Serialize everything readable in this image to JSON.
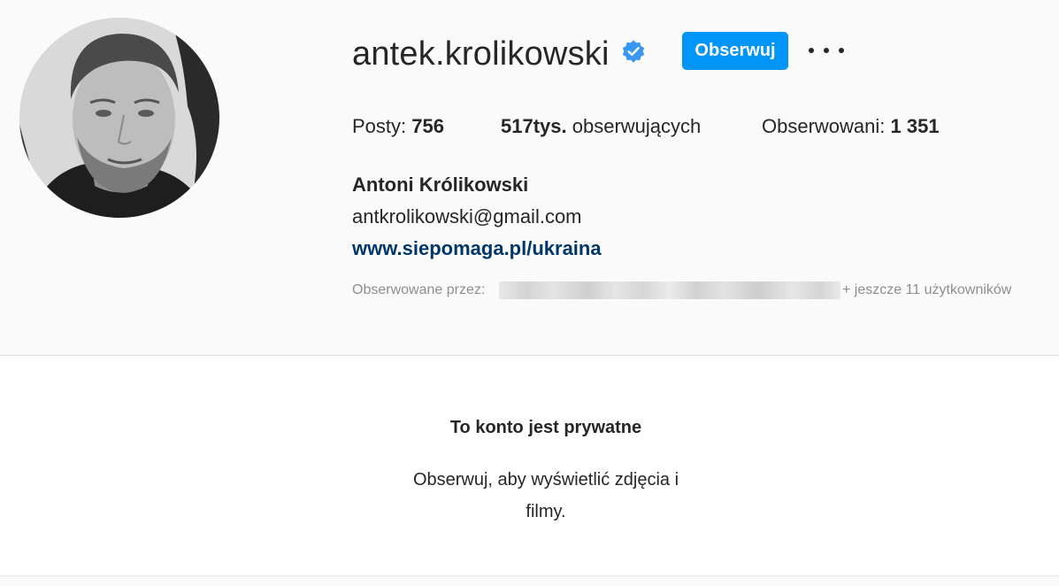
{
  "profile": {
    "username": "antek.krolikowski",
    "verified_icon": "verified-badge-icon",
    "follow_label": "Obserwuj",
    "more_icon": "more-options-icon",
    "stats": {
      "posts_label": "Posty:",
      "posts_value": "756",
      "followers_value": "517tys.",
      "followers_label": "obserwujących",
      "following_label": "Obserwowani:",
      "following_value": "1 351"
    },
    "full_name": "Antoni Królikowski",
    "email": "antkrolikowski@gmail.com",
    "link": "www.siepomaga.pl/ukraina",
    "followed_by_label": "Obserwowane przez:",
    "followed_by_more": "+ jeszcze 11 użytkowników"
  },
  "private": {
    "title": "To konto jest prywatne",
    "description": "Obserwuj, aby wyświetlić zdjęcia i filmy."
  },
  "colors": {
    "accent": "#0095f6",
    "link": "#00376b",
    "muted": "#8e8e8e",
    "background": "#fafafa"
  }
}
